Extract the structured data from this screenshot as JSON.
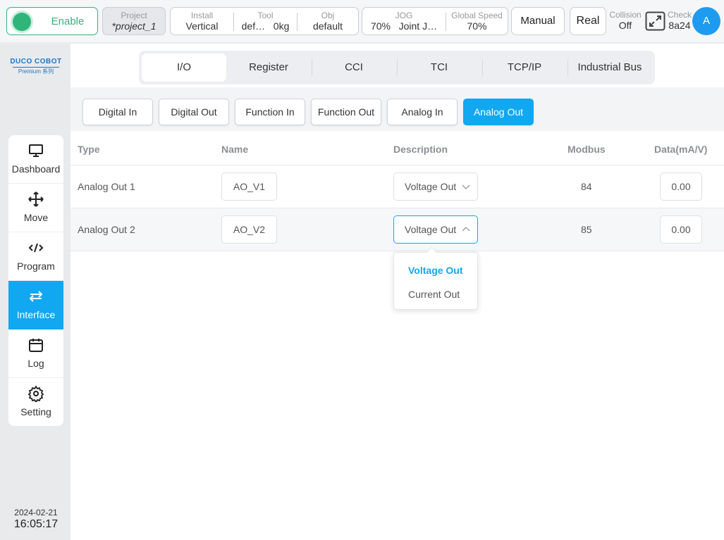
{
  "topbar": {
    "enable_label": "Enable",
    "project": {
      "label": "Project",
      "value": "*project_1"
    },
    "install": {
      "label": "Install",
      "value": "Vertical"
    },
    "tool": {
      "label": "Tool",
      "name": "def…",
      "weight": "0kg"
    },
    "obj": {
      "label": "Obj",
      "value": "default"
    },
    "jog": {
      "label": "JOG",
      "speed": "70%",
      "mode": "Joint J…"
    },
    "global_speed": {
      "label": "Global Speed",
      "value": "70%"
    },
    "manual_label": "Manual",
    "real_label": "Real",
    "collision": {
      "label": "Collision",
      "value": "Off"
    },
    "check": {
      "label": "Check",
      "value": "8a24"
    },
    "avatar_initial": "A"
  },
  "logo": {
    "brand": "DUCO COBOT",
    "series": "Premium 系列"
  },
  "sidebar": {
    "items": [
      {
        "label": "Dashboard",
        "icon": "monitor-icon"
      },
      {
        "label": "Move",
        "icon": "move-arrows-icon"
      },
      {
        "label": "Program",
        "icon": "code-icon"
      },
      {
        "label": "Interface",
        "icon": "swap-arrows-icon",
        "active": true
      },
      {
        "label": "Log",
        "icon": "calendar-icon"
      },
      {
        "label": "Setting",
        "icon": "gear-icon"
      }
    ]
  },
  "datetime": {
    "date": "2024-02-21",
    "time": "16:05:17"
  },
  "tabs": [
    "I/O",
    "Register",
    "CCI",
    "TCI",
    "TCP/IP",
    "Industrial Bus"
  ],
  "active_tab": "I/O",
  "subtabs": [
    "Digital In",
    "Digital Out",
    "Function In",
    "Function Out",
    "Analog In",
    "Analog Out"
  ],
  "active_subtab": "Analog Out",
  "table": {
    "headers": {
      "type": "Type",
      "name": "Name",
      "description": "Description",
      "modbus": "Modbus",
      "data": "Data(mA/V)"
    },
    "rows": [
      {
        "type": "Analog Out 1",
        "name": "AO_V1",
        "description": "Voltage Out",
        "modbus": "84",
        "data": "0.00"
      },
      {
        "type": "Analog Out 2",
        "name": "AO_V2",
        "description": "Voltage Out",
        "modbus": "85",
        "data": "0.00"
      }
    ]
  },
  "dropdown": {
    "options": [
      "Voltage Out",
      "Current Out"
    ],
    "selected": "Voltage Out"
  },
  "colors": {
    "accent": "#11a7f1",
    "enable": "#2fb57a",
    "avatar": "#1d9bf0"
  }
}
